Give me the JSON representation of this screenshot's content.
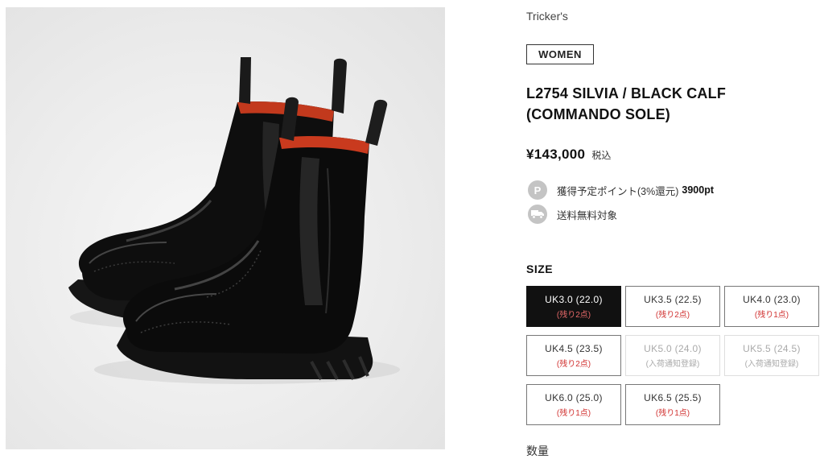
{
  "product": {
    "brand": "Tricker's",
    "gender": "WOMEN",
    "title_line1": "L2754 SILVIA / BLACK CALF",
    "title_line2": "(COMMANDO SOLE)",
    "price": "¥143,000",
    "tax_label": "税込",
    "image_alt": "black-chelsea-brogue-boots-photo"
  },
  "points": {
    "icon": "P",
    "icon_name": "points-icon",
    "label": "獲得予定ポイント(3%還元)",
    "value": "3900pt"
  },
  "shipping": {
    "icon_name": "truck-icon",
    "label": "送料無料対象"
  },
  "size": {
    "heading": "SIZE",
    "options": [
      {
        "label": "UK3.0 (22.0)",
        "status": "(残り2点)",
        "state": "selected"
      },
      {
        "label": "UK3.5 (22.5)",
        "status": "(残り2点)",
        "state": "available"
      },
      {
        "label": "UK4.0 (23.0)",
        "status": "(残り1点)",
        "state": "available"
      },
      {
        "label": "UK4.5 (23.5)",
        "status": "(残り2点)",
        "state": "available"
      },
      {
        "label": "UK5.0 (24.0)",
        "status": "(入荷通知登録)",
        "state": "disabled"
      },
      {
        "label": "UK5.5 (24.5)",
        "status": "(入荷通知登録)",
        "state": "disabled"
      },
      {
        "label": "UK6.0 (25.0)",
        "status": "(残り1点)",
        "state": "available"
      },
      {
        "label": "UK6.5 (25.5)",
        "status": "(残り1点)",
        "state": "available"
      }
    ]
  },
  "quantity": {
    "label": "数量"
  },
  "colors": {
    "accent_red": "#d0302f",
    "selected_bg": "#111111",
    "badge_gray": "#c4c4c4"
  }
}
